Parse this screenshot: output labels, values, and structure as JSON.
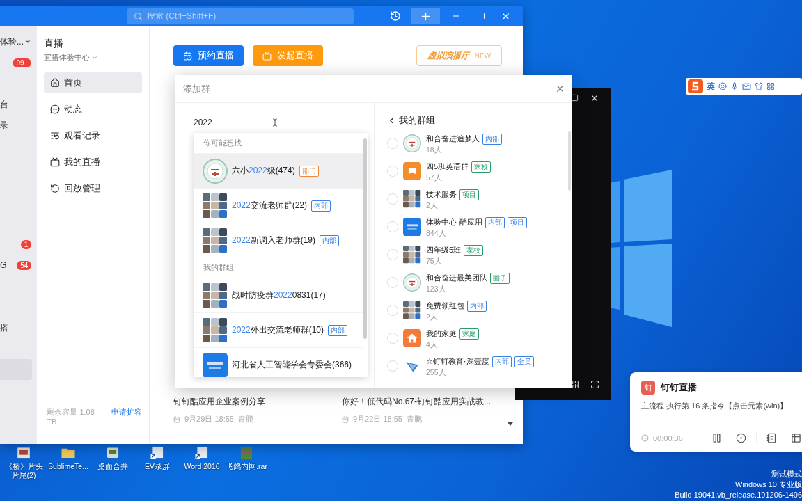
{
  "app": {
    "search_placeholder": "搜索 (Ctrl+Shift+F)",
    "org_sidebar": [
      {
        "label": "体验...",
        "caret": true,
        "selected": false
      },
      {
        "badge": "99+",
        "selected": false
      },
      {
        "selected": false
      },
      {
        "label": "台",
        "selected": false
      },
      {
        "label": "录",
        "selected": false,
        "divider_after": true
      },
      {
        "selected": false
      },
      {
        "selected": false
      },
      {
        "selected": false
      },
      {
        "selected": false
      },
      {
        "badge": "1",
        "selected": false
      },
      {
        "label": "G",
        "badge": "54",
        "selected": false
      },
      {
        "selected": false
      },
      {
        "selected": false
      },
      {
        "label": "搭",
        "selected": false
      },
      {
        "selected": false
      },
      {
        "selected": true
      }
    ],
    "nav": {
      "title": "直播",
      "org": "宜搭体验中心",
      "items": [
        {
          "label": "首页",
          "selected": true
        },
        {
          "label": "动态",
          "selected": false
        },
        {
          "label": "观看记录",
          "selected": false
        },
        {
          "label": "我的直播",
          "selected": false
        },
        {
          "label": "回放管理",
          "selected": false
        }
      ],
      "storage": "剩余容量 1.08 TB",
      "expand_link": "申请扩容"
    },
    "actions": [
      {
        "label": "预约直播",
        "kind": "primary"
      },
      {
        "label": "发起直播",
        "kind": "warning"
      }
    ],
    "promo": {
      "label": "虚拟演播厅",
      "badge": "NEW"
    },
    "cards": [
      {
        "title": "钉钉酷应用企业案例分享",
        "date": "9月29日 18:55",
        "author": "青鹏"
      },
      {
        "title": "你好！低代码No.67-钉钉酷应用实战教...",
        "date": "9月22日 18:55",
        "author": "青鹏"
      }
    ]
  },
  "dialog": {
    "title": "添加群",
    "search_value": "2022",
    "sections": [
      {
        "heading": "你可能想找",
        "items": [
          {
            "name_parts": [
              {
                "text": "六小",
                "match": false
              },
              {
                "text": "2022",
                "match": true
              },
              {
                "text": "级(474)",
                "match": false
              }
            ],
            "tag": {
              "label": "部门",
              "color": "#f0883a"
            },
            "selected": true
          },
          {
            "name_parts": [
              {
                "text": "2022",
                "match": true
              },
              {
                "text": "交流老师群(22)",
                "match": false
              }
            ],
            "tag": {
              "label": "内部",
              "color": "#3a83e6"
            },
            "selected": false
          },
          {
            "name_parts": [
              {
                "text": "2022",
                "match": true
              },
              {
                "text": "新调入老师群(19)",
                "match": false
              }
            ],
            "tag": {
              "label": "内部",
              "color": "#3a83e6"
            },
            "selected": false
          }
        ]
      },
      {
        "heading": "我的群组",
        "items": [
          {
            "name_parts": [
              {
                "text": "战时防疫群",
                "match": false
              },
              {
                "text": "2022",
                "match": true
              },
              {
                "text": "0831(17)",
                "match": false
              }
            ],
            "selected": false
          },
          {
            "name_parts": [
              {
                "text": "2022",
                "match": true
              },
              {
                "text": "外出交流老师群(10)",
                "match": false
              }
            ],
            "tag": {
              "label": "内部",
              "color": "#3a83e6"
            },
            "selected": false
          },
          {
            "name_parts": [
              {
                "text": "河北省人工智能学会专委会(366)",
                "match": false
              }
            ],
            "selected": false
          }
        ]
      }
    ],
    "my_groups": {
      "title": "我的群组",
      "items": [
        {
          "name": "和合奋进追梦人",
          "count": "18人",
          "checked": false,
          "tags": [
            {
              "label": "内部",
              "color": "#3a83e6"
            }
          ]
        },
        {
          "name": "四5班英语群",
          "count": "57人",
          "checked": false,
          "tags": [
            {
              "label": "家校",
              "color": "#2a9d68"
            }
          ]
        },
        {
          "name": "技术服务",
          "count": "2人",
          "checked": false,
          "tags": [
            {
              "label": "项目",
              "color": "#2a9d68"
            }
          ]
        },
        {
          "name": "体验中心-酷应用",
          "count": "844人",
          "checked": false,
          "tags": [
            {
              "label": "内部",
              "color": "#3a83e6"
            },
            {
              "label": "项目",
              "color": "#3a83e6"
            }
          ]
        },
        {
          "name": "四年级5班",
          "count": "75人",
          "checked": false,
          "tags": [
            {
              "label": "家校",
              "color": "#2a9d68"
            }
          ]
        },
        {
          "name": "和合奋进最美团队",
          "count": "123人",
          "checked": false,
          "tags": [
            {
              "label": "圈子",
              "color": "#2a9d68"
            }
          ]
        },
        {
          "name": "免费领红包",
          "count": "2人",
          "checked": false,
          "tags": [
            {
              "label": "内部",
              "color": "#3a83e6"
            }
          ]
        },
        {
          "name": "我的家庭",
          "count": "4人",
          "checked": false,
          "tags": [
            {
              "label": "家庭",
              "color": "#2a9d68"
            }
          ]
        },
        {
          "name": "☆钉钉教育·深壹度",
          "count": "255人",
          "checked": false,
          "tags": [
            {
              "label": "内部",
              "color": "#3a83e6"
            },
            {
              "label": "全员",
              "color": "#3a83e6"
            }
          ]
        }
      ]
    }
  },
  "ime_bar": {
    "mode": "英"
  },
  "notification": {
    "app_icon": "钉",
    "app": "钉钉直播",
    "message": "主流程 执行第 16 条指令【点击元素(win)】",
    "elapsed": "00:00:36"
  },
  "desktop_icons": [
    {
      "label": "《桥》片头片尾(2)"
    },
    {
      "label": "SublimeTe..."
    },
    {
      "label": "桌面合并"
    },
    {
      "label": "EV录屏"
    },
    {
      "label": "Word 2016"
    },
    {
      "label": "飞鸽内网.rar"
    }
  ],
  "os_watermark": [
    "测试模式",
    "Windows 10 专业版",
    "Build 19041.vb_release.191206-1406"
  ]
}
